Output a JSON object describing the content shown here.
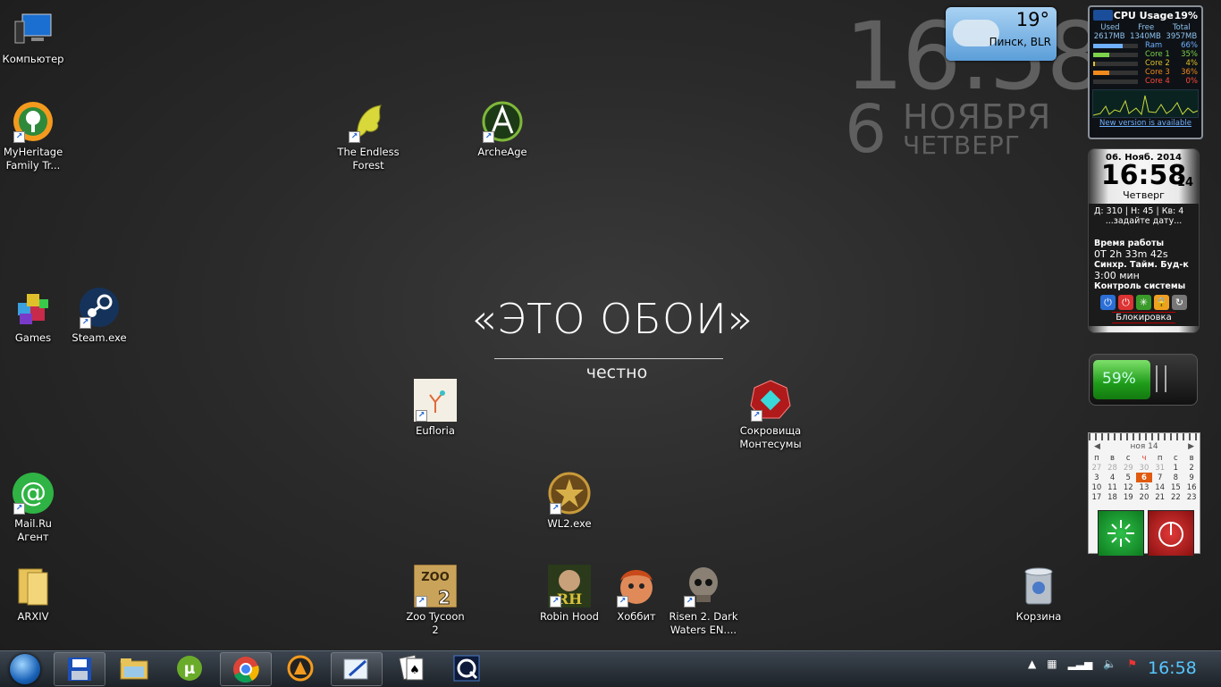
{
  "wallpaper": {
    "title": "«ЭТО ОБОИ»",
    "subtitle": "честно"
  },
  "big_clock": {
    "time": "16:58",
    "day": "6",
    "month": "НОЯБРЯ",
    "weekday": "ЧЕТВЕРГ"
  },
  "weather": {
    "temp": "19°",
    "city": "Пинск, BLR"
  },
  "cpu": {
    "title": "CPU Usage",
    "usage": "19%",
    "headers": [
      "Used",
      "Free",
      "Total"
    ],
    "values": [
      "2617MB",
      "1340MB",
      "3957MB"
    ],
    "rows": [
      {
        "name": "Ram",
        "pct": "66%",
        "color": "#6fb0ff"
      },
      {
        "name": "Core 1",
        "pct": "35%",
        "color": "#7dd34a"
      },
      {
        "name": "Core 2",
        "pct": "4%",
        "color": "#e0c22a"
      },
      {
        "name": "Core 3",
        "pct": "36%",
        "color": "#f08a1c"
      },
      {
        "name": "Core 4",
        "pct": "0%",
        "color": "#ff4a3a"
      }
    ],
    "new_version": "New version is available"
  },
  "sysclock": {
    "date": "06. Нояб. 2014",
    "time": "16:58",
    "sec": "14",
    "weekday": "Четверг",
    "line1": "Д: 310 |   Н: 45 |    Кв: 4",
    "line2": "...задайте дату...",
    "uptime_label": "Время работы",
    "uptime": "0T 2h 33m 42s",
    "sync": "Синхр.  Тайм.  Буд-к",
    "interval": "3:00 мин",
    "control": "Контроль системы",
    "lock": "Блокировка"
  },
  "battery": {
    "pct": "59%"
  },
  "calendar": {
    "month": "ноя 14",
    "days": [
      "п",
      "в",
      "с",
      "ч",
      "п",
      "с",
      "в"
    ],
    "weeks": [
      [
        "27",
        "28",
        "29",
        "30",
        "31",
        "1",
        "2"
      ],
      [
        "3",
        "4",
        "5",
        "6",
        "7",
        "8",
        "9"
      ],
      [
        "10",
        "11",
        "12",
        "13",
        "14",
        "15",
        "16"
      ],
      [
        "17",
        "18",
        "19",
        "20",
        "21",
        "22",
        "23"
      ]
    ]
  },
  "icons": {
    "computer": "Компьютер",
    "myheritage": "MyHeritage\nFamily Tr...",
    "endless_forest": "The Endless\nForest",
    "archeage": "ArcheAge",
    "games": "Games",
    "steam": "Steam.exe",
    "eufloria": "Eufloria",
    "montezuma": "Сокровища\nМонтесумы",
    "wl2": "WL2.exe",
    "mailru": "Mail.Ru\nАгент",
    "arxiv": "ARXIV",
    "zoo": "Zoo Tycoon\n2",
    "robin": "Robin Hood",
    "hobbit": "Хоббит",
    "risen": "Risen 2. Dark\nWaters EN....",
    "recycle": "Корзина"
  },
  "taskbar": {
    "clock": "16:58"
  }
}
